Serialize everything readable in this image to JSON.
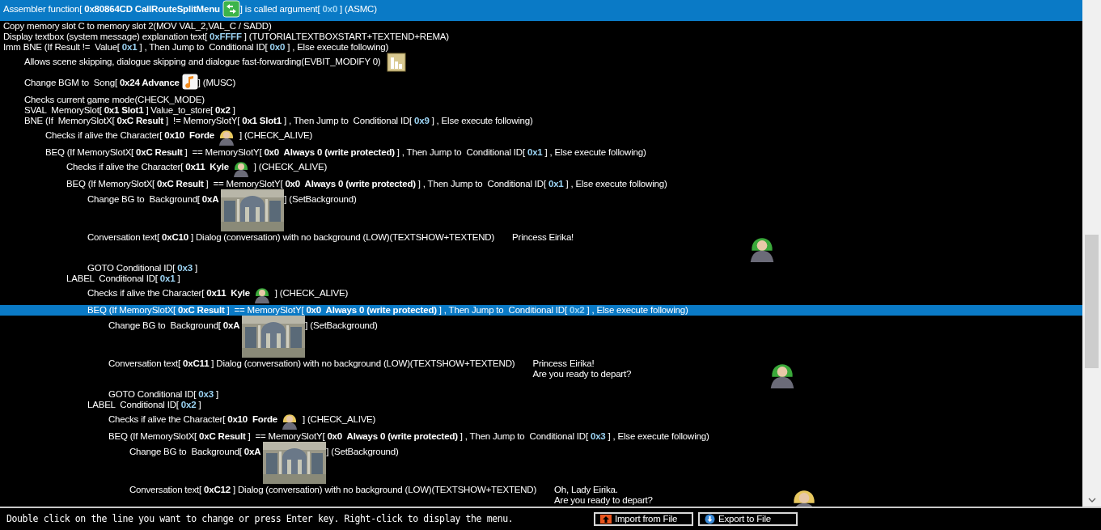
{
  "script_lines": [
    {
      "selected": true,
      "parts": [
        {
          "kind": "text",
          "text": "Assembler function["
        },
        {
          "kind": "value",
          "text": "0x80864CD CallRouteSplitMenu"
        },
        {
          "kind": "routes"
        },
        {
          "kind": "text",
          "text": "] is called argument["
        },
        {
          "kind": "number",
          "text": "0x0"
        },
        {
          "kind": "text",
          "text": "] (ASMC)"
        }
      ]
    },
    {
      "selected": false,
      "parts": [
        {
          "kind": "text",
          "text": "Copy memory slot C to memory slot 2(MOV VAL_2,VAL_C / SADD)"
        }
      ]
    },
    {
      "selected": false,
      "parts": [
        {
          "kind": "text",
          "text": "Display textbox (system message) explanation text["
        },
        {
          "kind": "number",
          "text": "0xFFFF"
        },
        {
          "kind": "text",
          "text": "] (TUTORIALTEXTBOXSTART+TEXTEND+REMA)"
        }
      ]
    },
    {
      "selected": false,
      "parts": [
        {
          "kind": "text",
          "text": "Imm BNE (If Result !=  Value["
        },
        {
          "kind": "number",
          "text": "0x1"
        },
        {
          "kind": "text",
          "text": "] , Then Jump to  Conditional ID["
        },
        {
          "kind": "number",
          "text": "0x0"
        },
        {
          "kind": "text",
          "text": "] , Else execute following)"
        }
      ],
      "children": [
        {
          "selected": false,
          "parts": [
            {
              "kind": "text",
              "text": "Allows scene skipping, dialogue skipping and dialogue fast-forwarding(EVBIT_MODIFY 0)"
            },
            {
              "kind": "chart"
            }
          ]
        },
        {
          "selected": false,
          "parts": [
            {
              "kind": "text",
              "text": "Change BGM to  Song["
            },
            {
              "kind": "value",
              "text": "0x24 Advance"
            },
            {
              "kind": "music"
            },
            {
              "kind": "text",
              "text": "] (MUSC)"
            }
          ]
        },
        {
          "selected": false,
          "parts": [
            {
              "kind": "text",
              "text": "Checks current game mode(CHECK_MODE)"
            }
          ]
        },
        {
          "selected": false,
          "parts": [
            {
              "kind": "text",
              "text": "SVAL  MemorySlot["
            },
            {
              "kind": "value",
              "text": "0x1 Slot1"
            },
            {
              "kind": "text",
              "text": "] Value_to_store["
            },
            {
              "kind": "value",
              "text": "0x2"
            },
            {
              "kind": "text",
              "text": "]"
            }
          ]
        },
        {
          "selected": false,
          "parts": [
            {
              "kind": "text",
              "text": "BNE (If  MemorySlotX["
            },
            {
              "kind": "value",
              "text": "0xC Result"
            },
            {
              "kind": "text",
              "text": "]  != MemorySlotY["
            },
            {
              "kind": "value",
              "text": "0x1 Slot1"
            },
            {
              "kind": "text",
              "text": "] , Then Jump to  Conditional ID["
            },
            {
              "kind": "number",
              "text": "0x9"
            },
            {
              "kind": "text",
              "text": "] , Else execute following)"
            }
          ],
          "children": [
            {
              "selected": false,
              "parts": [
                {
                  "kind": "text",
                  "text": "Checks if alive the Character["
                },
                {
                  "kind": "value",
                  "text": "0x10  Forde"
                },
                {
                  "kind": "portrait",
                  "color": "#e8c860"
                },
                {
                  "kind": "text",
                  "text": "] (CHECK_ALIVE)"
                }
              ]
            },
            {
              "selected": false,
              "parts": [
                {
                  "kind": "text",
                  "text": "BEQ (If MemorySlotX["
                },
                {
                  "kind": "value",
                  "text": "0xC Result"
                },
                {
                  "kind": "text",
                  "text": "]  == MemorySlotY["
                },
                {
                  "kind": "value",
                  "text": "0x0  Always 0 (write protected)"
                },
                {
                  "kind": "text",
                  "text": "] , Then Jump to  Conditional ID["
                },
                {
                  "kind": "number",
                  "text": "0x1"
                },
                {
                  "kind": "text",
                  "text": "] , Else execute following)"
                }
              ],
              "children": [
                {
                  "selected": false,
                  "parts": [
                    {
                      "kind": "text",
                      "text": "Checks if alive the Character["
                    },
                    {
                      "kind": "value",
                      "text": "0x11  Kyle"
                    },
                    {
                      "kind": "portrait",
                      "color": "#3aa83a"
                    },
                    {
                      "kind": "text",
                      "text": "] (CHECK_ALIVE)"
                    }
                  ]
                },
                {
                  "selected": false,
                  "parts": [
                    {
                      "kind": "text",
                      "text": "BEQ (If MemorySlotX["
                    },
                    {
                      "kind": "value",
                      "text": "0xC Result"
                    },
                    {
                      "kind": "text",
                      "text": "]  == MemorySlotY["
                    },
                    {
                      "kind": "value",
                      "text": "0x0  Always 0 (write protected)"
                    },
                    {
                      "kind": "text",
                      "text": "] , Then Jump to  Conditional ID["
                    },
                    {
                      "kind": "number",
                      "text": "0x1"
                    },
                    {
                      "kind": "text",
                      "text": "] , Else execute following)"
                    }
                  ],
                  "children": [
                    {
                      "selected": false,
                      "parts": [
                        {
                          "kind": "text",
                          "text": "Change BG to  Background["
                        },
                        {
                          "kind": "value",
                          "text": "0xA"
                        },
                        {
                          "kind": "picture"
                        },
                        {
                          "kind": "text",
                          "text": "] (SetBackground)"
                        }
                      ]
                    },
                    {
                      "selected": false,
                      "parts": [
                        {
                          "kind": "text",
                          "text": "Conversation text["
                        },
                        {
                          "kind": "value",
                          "text": "0xC10"
                        },
                        {
                          "kind": "text",
                          "text": "] Dialog (conversation) with no background (LOW)(TEXTSHOW+TEXTEND)"
                        }
                      ],
                      "dialog": [
                        "Princess Eirika!"
                      ],
                      "speaker": {
                        "color": "#3aa83a"
                      }
                    },
                    {
                      "selected": false,
                      "parts": [
                        {
                          "kind": "text",
                          "text": "GOTO Conditional ID["
                        },
                        {
                          "kind": "number",
                          "text": "0x3"
                        },
                        {
                          "kind": "text",
                          "text": "]"
                        }
                      ]
                    }
                  ]
                },
                {
                  "selected": false,
                  "parts": [
                    {
                      "kind": "text",
                      "text": "LABEL  Conditional ID["
                    },
                    {
                      "kind": "number",
                      "text": "0x1"
                    },
                    {
                      "kind": "text",
                      "text": "]"
                    }
                  ],
                  "children": [
                    {
                      "selected": false,
                      "parts": [
                        {
                          "kind": "text",
                          "text": "Checks if alive the Character["
                        },
                        {
                          "kind": "value",
                          "text": "0x11  Kyle"
                        },
                        {
                          "kind": "portrait",
                          "color": "#3aa83a"
                        },
                        {
                          "kind": "text",
                          "text": "] (CHECK_ALIVE)"
                        }
                      ]
                    },
                    {
                      "selected": true,
                      "parts": [
                        {
                          "kind": "text",
                          "text": "BEQ (If MemorySlotX["
                        },
                        {
                          "kind": "value",
                          "text": "0xC Result"
                        },
                        {
                          "kind": "text",
                          "text": "]  == MemorySlotY["
                        },
                        {
                          "kind": "value",
                          "text": "0x0  Always 0 (write protected)"
                        },
                        {
                          "kind": "text",
                          "text": "] , Then Jump to  Conditional ID["
                        },
                        {
                          "kind": "number",
                          "text": "0x2"
                        },
                        {
                          "kind": "text",
                          "text": "] , Else execute following)"
                        }
                      ],
                      "children": [
                        {
                          "selected": false,
                          "parts": [
                            {
                              "kind": "text",
                              "text": "Change BG to  Background["
                            },
                            {
                              "kind": "value",
                              "text": "0xA"
                            },
                            {
                              "kind": "picture"
                            },
                            {
                              "kind": "text",
                              "text": "] (SetBackground)"
                            }
                          ]
                        },
                        {
                          "selected": false,
                          "parts": [
                            {
                              "kind": "text",
                              "text": "Conversation text["
                            },
                            {
                              "kind": "value",
                              "text": "0xC11"
                            },
                            {
                              "kind": "text",
                              "text": "] Dialog (conversation) with no background (LOW)(TEXTSHOW+TEXTEND)"
                            }
                          ],
                          "dialog": [
                            "Princess Eirika!",
                            "Are you ready to depart?"
                          ],
                          "speaker": {
                            "color": "#3aa83a"
                          }
                        },
                        {
                          "selected": false,
                          "parts": [
                            {
                              "kind": "text",
                              "text": "GOTO Conditional ID["
                            },
                            {
                              "kind": "number",
                              "text": "0x3"
                            },
                            {
                              "kind": "text",
                              "text": "]"
                            }
                          ]
                        }
                      ]
                    },
                    {
                      "selected": false,
                      "parts": [
                        {
                          "kind": "text",
                          "text": "LABEL  Conditional ID["
                        },
                        {
                          "kind": "number",
                          "text": "0x2"
                        },
                        {
                          "kind": "text",
                          "text": "]"
                        }
                      ],
                      "children": [
                        {
                          "selected": false,
                          "parts": [
                            {
                              "kind": "text",
                              "text": "Checks if alive the Character["
                            },
                            {
                              "kind": "value",
                              "text": "0x10  Forde"
                            },
                            {
                              "kind": "portrait",
                              "color": "#e8c860"
                            },
                            {
                              "kind": "text",
                              "text": "] (CHECK_ALIVE)"
                            }
                          ]
                        },
                        {
                          "selected": false,
                          "parts": [
                            {
                              "kind": "text",
                              "text": "BEQ (If MemorySlotX["
                            },
                            {
                              "kind": "value",
                              "text": "0xC Result"
                            },
                            {
                              "kind": "text",
                              "text": "]  == MemorySlotY["
                            },
                            {
                              "kind": "value",
                              "text": "0x0  Always 0 (write protected)"
                            },
                            {
                              "kind": "text",
                              "text": "] , Then Jump to  Conditional ID["
                            },
                            {
                              "kind": "number",
                              "text": "0x3"
                            },
                            {
                              "kind": "text",
                              "text": "] , Else execute following)"
                            }
                          ],
                          "children": [
                            {
                              "selected": false,
                              "parts": [
                                {
                                  "kind": "text",
                                  "text": "Change BG to  Background["
                                },
                                {
                                  "kind": "value",
                                  "text": "0xA"
                                },
                                {
                                  "kind": "picture"
                                },
                                {
                                  "kind": "text",
                                  "text": "] (SetBackground)"
                                }
                              ]
                            },
                            {
                              "selected": false,
                              "parts": [
                                {
                                  "kind": "text",
                                  "text": "Conversation text["
                                },
                                {
                                  "kind": "value",
                                  "text": "0xC12"
                                },
                                {
                                  "kind": "text",
                                  "text": "] Dialog (conversation) with no background (LOW)(TEXTSHOW+TEXTEND)"
                                }
                              ],
                              "dialog": [
                                "Oh, Lady Eirika.",
                                "Are you ready to depart?"
                              ],
                              "speaker": {
                                "color": "#e8c860"
                              }
                            }
                          ]
                        }
                      ]
                    }
                  ]
                }
              ]
            }
          ]
        }
      ]
    }
  ],
  "status_bar": {
    "hint": "Double click on the line you want to change or press Enter key. Right-click to display the menu.",
    "buttons": [
      {
        "label": "Import from File",
        "kind": "import"
      },
      {
        "label": "Export to File",
        "kind": "export"
      }
    ]
  }
}
